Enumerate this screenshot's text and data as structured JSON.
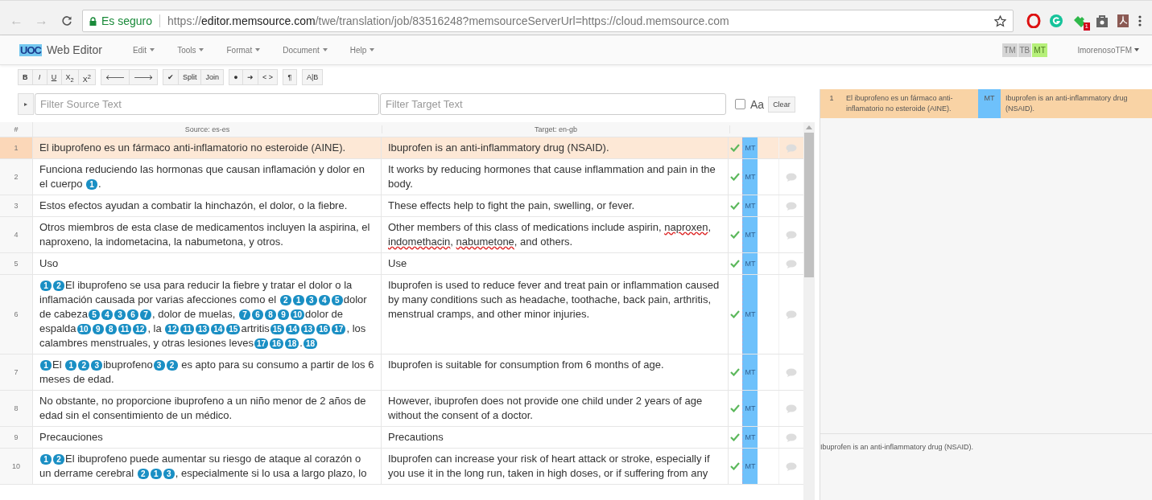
{
  "browser": {
    "back": "←",
    "forward": "→",
    "secure_label": "Es seguro",
    "url": {
      "scheme": "https://",
      "host": "editor.memsource.com",
      "path": "/twe/translation/job/83516248?memsourceServerUrl=https://cloud.memsource.com"
    },
    "extension_badge": "1"
  },
  "app": {
    "logo": "UOC",
    "title": "Web Editor",
    "menus": [
      "Edit",
      "Tools",
      "Format",
      "Document",
      "Help"
    ],
    "providers": [
      {
        "label": "TM",
        "active": false
      },
      {
        "label": "TB",
        "active": false
      },
      {
        "label": "MT",
        "active": true
      }
    ],
    "user": "lmorenosoTFM"
  },
  "toolbar": [
    [
      {
        "kind": "bold",
        "label": "B"
      },
      {
        "kind": "italic",
        "label": "I"
      },
      {
        "kind": "underline",
        "label": "U"
      },
      {
        "kind": "plain",
        "label": "X$_{2}$"
      },
      {
        "kind": "plain",
        "label": "X$^{2}$"
      }
    ],
    [
      {
        "kind": "plain",
        "label": "🡐"
      },
      {
        "kind": "plain",
        "label": "🡒"
      }
    ],
    [
      {
        "kind": "plain",
        "label": "✔"
      },
      {
        "kind": "plain",
        "label": "Split"
      },
      {
        "kind": "plain",
        "label": "Join"
      }
    ],
    [
      {
        "kind": "plain",
        "label": "●"
      },
      {
        "kind": "plain",
        "label": "➜"
      },
      {
        "kind": "plain",
        "label": "< >"
      }
    ],
    [
      {
        "kind": "plain",
        "label": "¶"
      }
    ],
    [
      {
        "kind": "plain",
        "label": "A|B"
      }
    ]
  ],
  "filters": {
    "expand": "▸",
    "source_placeholder": "Filter Source Text",
    "target_placeholder": "Filter Target Text",
    "match_case": {
      "label": "Aa",
      "checked": false
    },
    "clear": "Clear"
  },
  "table": {
    "columns": [
      "#",
      "Source: es-es",
      "Target: en-gb"
    ],
    "rows": [
      {
        "number": "1",
        "selected": true,
        "confirmed": true,
        "origin": "MT",
        "source": [
          {
            "kind": "text",
            "text": "El ibuprofeno es un fármaco anti-inflamatorio no esteroide (AINE)."
          }
        ],
        "target": [
          {
            "text": "Ibuprofen is an anti-inflammatory drug (NSAID).",
            "misspelled": false
          }
        ]
      },
      {
        "number": "2",
        "selected": false,
        "confirmed": true,
        "origin": "MT",
        "source": [
          {
            "kind": "text",
            "text": "Funciona reduciendo las hormonas que causan inflamación y dolor en el cuerpo "
          },
          {
            "kind": "tag",
            "text": "1"
          },
          {
            "kind": "text",
            "text": "."
          }
        ],
        "target": [
          {
            "text": "It works by reducing hormones that cause inflammation and pain in the body.",
            "misspelled": false
          }
        ]
      },
      {
        "number": "3",
        "selected": false,
        "confirmed": true,
        "origin": "MT",
        "source": [
          {
            "kind": "text",
            "text": "Estos efectos ayudan a combatir la hinchazón, el dolor, o la fiebre."
          }
        ],
        "target": [
          {
            "text": "These effects help to fight the pain, swelling, or fever.",
            "misspelled": false
          }
        ]
      },
      {
        "number": "4",
        "selected": false,
        "confirmed": true,
        "origin": "MT",
        "source": [
          {
            "kind": "text",
            "text": "Otros miembros de esta clase de medicamentos incluyen la aspirina, el naproxeno, la indometacina, la nabumetona, y otros."
          }
        ],
        "target": [
          {
            "text": "Other members of this class of medications include aspirin, ",
            "misspelled": false
          },
          {
            "text": "naproxen",
            "misspelled": true
          },
          {
            "text": ", ",
            "misspelled": false
          },
          {
            "text": "indomethacin",
            "misspelled": true
          },
          {
            "text": ", ",
            "misspelled": false
          },
          {
            "text": "nabumetone",
            "misspelled": true
          },
          {
            "text": ", and others.",
            "misspelled": false
          }
        ]
      },
      {
        "number": "5",
        "selected": false,
        "confirmed": true,
        "origin": "MT",
        "source": [
          {
            "kind": "text",
            "text": "Uso"
          }
        ],
        "target": [
          {
            "text": "Use",
            "misspelled": false
          }
        ]
      },
      {
        "number": "6",
        "selected": false,
        "confirmed": true,
        "origin": "MT",
        "source": [
          {
            "kind": "tag",
            "text": "1"
          },
          {
            "kind": "tag",
            "text": "2"
          },
          {
            "kind": "text",
            "text": "El ibuprofeno se usa para reducir la fiebre y tratar el dolor o la inflamación causada por varias afecciones como el "
          },
          {
            "kind": "tag",
            "text": "2"
          },
          {
            "kind": "tag",
            "text": "1"
          },
          {
            "kind": "tag",
            "text": "3"
          },
          {
            "kind": "tag",
            "text": "4"
          },
          {
            "kind": "tag",
            "text": "5"
          },
          {
            "kind": "text",
            "text": "dolor de cabeza"
          },
          {
            "kind": "tag",
            "text": "5"
          },
          {
            "kind": "tag",
            "text": "4"
          },
          {
            "kind": "tag",
            "text": "3"
          },
          {
            "kind": "tag",
            "text": "6"
          },
          {
            "kind": "tag",
            "text": "7"
          },
          {
            "kind": "text",
            "text": ", dolor de muelas, "
          },
          {
            "kind": "tag",
            "text": "7"
          },
          {
            "kind": "tag",
            "text": "6"
          },
          {
            "kind": "tag",
            "text": "8"
          },
          {
            "kind": "tag",
            "text": "9"
          },
          {
            "kind": "tag",
            "text": "10"
          },
          {
            "kind": "text",
            "text": "dolor de espalda"
          },
          {
            "kind": "tag",
            "text": "10"
          },
          {
            "kind": "tag",
            "text": "9"
          },
          {
            "kind": "tag",
            "text": "8"
          },
          {
            "kind": "tag",
            "text": "11"
          },
          {
            "kind": "tag",
            "text": "12"
          },
          {
            "kind": "text",
            "text": ", la "
          },
          {
            "kind": "tag",
            "text": "12"
          },
          {
            "kind": "tag",
            "text": "11"
          },
          {
            "kind": "tag",
            "text": "13"
          },
          {
            "kind": "tag",
            "text": "14"
          },
          {
            "kind": "tag",
            "text": "15"
          },
          {
            "kind": "text",
            "text": "artritis"
          },
          {
            "kind": "tag",
            "text": "15"
          },
          {
            "kind": "tag",
            "text": "14"
          },
          {
            "kind": "tag",
            "text": "13"
          },
          {
            "kind": "tag",
            "text": "16"
          },
          {
            "kind": "tag",
            "text": "17"
          },
          {
            "kind": "text",
            "text": ", los calambres menstruales, y otras lesiones leves"
          },
          {
            "kind": "tag",
            "text": "17"
          },
          {
            "kind": "tag",
            "text": "16"
          },
          {
            "kind": "tag",
            "text": "18"
          },
          {
            "kind": "text",
            "text": "."
          },
          {
            "kind": "tag",
            "text": "18"
          }
        ],
        "target": [
          {
            "text": "Ibuprofen is used to reduce fever and treat pain or inflammation caused by many conditions such as headache, toothache, back pain, arthritis, menstrual cramps, and other minor injuries.",
            "misspelled": false
          }
        ]
      },
      {
        "number": "7",
        "selected": false,
        "confirmed": true,
        "origin": "MT",
        "source": [
          {
            "kind": "tag",
            "text": "1"
          },
          {
            "kind": "text",
            "text": "El "
          },
          {
            "kind": "tag",
            "text": "1"
          },
          {
            "kind": "tag",
            "text": "2"
          },
          {
            "kind": "tag",
            "text": "3"
          },
          {
            "kind": "text",
            "text": "ibuprofeno"
          },
          {
            "kind": "tag",
            "text": "3"
          },
          {
            "kind": "tag",
            "text": "2"
          },
          {
            "kind": "text",
            "text": " es apto para su consumo a partir de los 6 meses de edad."
          }
        ],
        "target": [
          {
            "text": "Ibuprofen is suitable for consumption from 6 months of age.",
            "misspelled": false
          }
        ]
      },
      {
        "number": "8",
        "selected": false,
        "confirmed": true,
        "origin": "MT",
        "source": [
          {
            "kind": "text",
            "text": "No obstante, no proporcione ibuprofeno a un niño menor de 2 años de edad sin el consentimiento de un médico."
          }
        ],
        "target": [
          {
            "text": "However, ibuprofen does not provide one child under 2 years of age without the consent of a doctor.",
            "misspelled": false
          }
        ]
      },
      {
        "number": "9",
        "selected": false,
        "confirmed": true,
        "origin": "MT",
        "source": [
          {
            "kind": "text",
            "text": "Precauciones"
          }
        ],
        "target": [
          {
            "text": "Precautions",
            "misspelled": false
          }
        ]
      },
      {
        "number": "10",
        "selected": false,
        "confirmed": true,
        "origin": "MT",
        "source": [
          {
            "kind": "tag",
            "text": "1"
          },
          {
            "kind": "tag",
            "text": "2"
          },
          {
            "kind": "text",
            "text": "El ibuprofeno puede aumentar su riesgo de ataque al corazón o un derrame cerebral "
          },
          {
            "kind": "tag",
            "text": "2"
          },
          {
            "kind": "tag",
            "text": "1"
          },
          {
            "kind": "tag",
            "text": "3"
          },
          {
            "kind": "text",
            "text": ", especialmente si lo usa a largo plazo, lo"
          }
        ],
        "target": [
          {
            "text": "Ibuprofen can increase your risk of heart attack or stroke, especially if you use it in the long run, taken in high doses, or if suffering from any",
            "misspelled": false
          }
        ]
      }
    ]
  },
  "match_panel": {
    "matches": [
      {
        "number": "1",
        "source": "El ibuprofeno es un fármaco anti-inflamatorio no esteroide (AINE).",
        "origin": "MT",
        "target": "Ibuprofen is an anti-inflammatory drug (NSAID)."
      }
    ],
    "preview": "Ibuprofen is an anti-inflammatory drug (NSAID)."
  }
}
